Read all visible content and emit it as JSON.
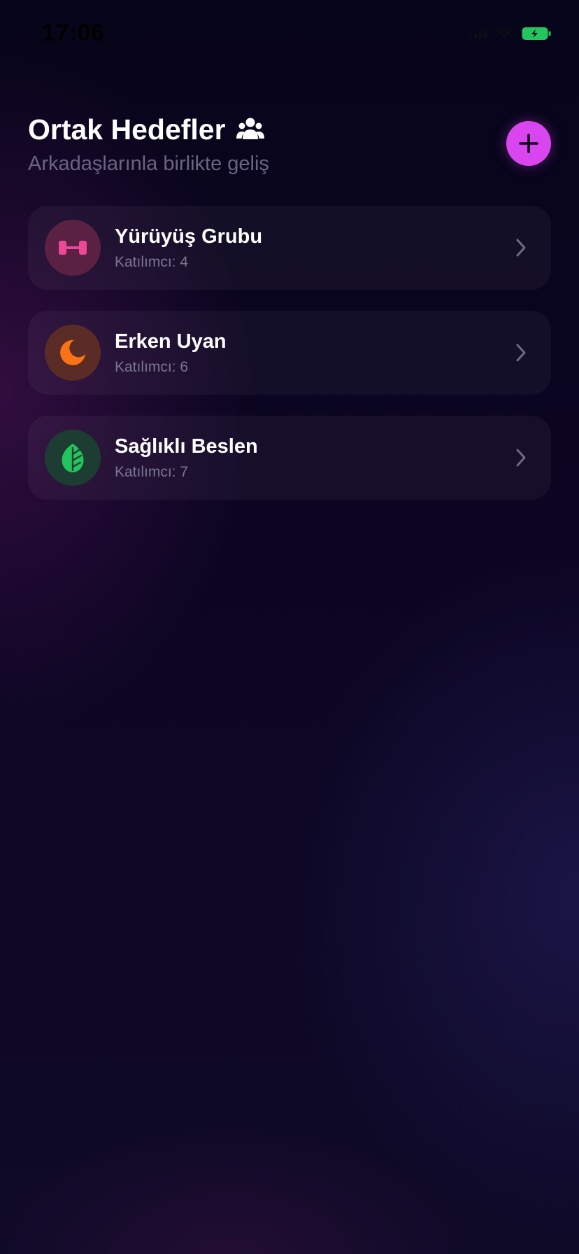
{
  "status_bar": {
    "time": "17:06"
  },
  "header": {
    "title": "Ortak Hedefler",
    "subtitle": "Arkadaşlarınla birlikte geliş",
    "title_icon": "people-icon",
    "add_button_icon": "plus-icon"
  },
  "goals": [
    {
      "name": "Yürüyüş Grubu",
      "participants_label": "Katılımcı: 4",
      "icon": "dumbbell-icon",
      "icon_color": "#ec4899",
      "icon_bg": "#5a2142"
    },
    {
      "name": "Erken Uyan",
      "participants_label": "Katılımcı: 6",
      "icon": "moon-icon",
      "icon_color": "#f97316",
      "icon_bg": "#5b2c25"
    },
    {
      "name": "Sağlıklı Beslen",
      "participants_label": "Katılımcı: 7",
      "icon": "leaf-icon",
      "icon_color": "#22c55e",
      "icon_bg": "#1d3d32"
    }
  ],
  "colors": {
    "accent": "#d946ef",
    "subtitle": "#6b6480",
    "battery": "#22c55e"
  }
}
